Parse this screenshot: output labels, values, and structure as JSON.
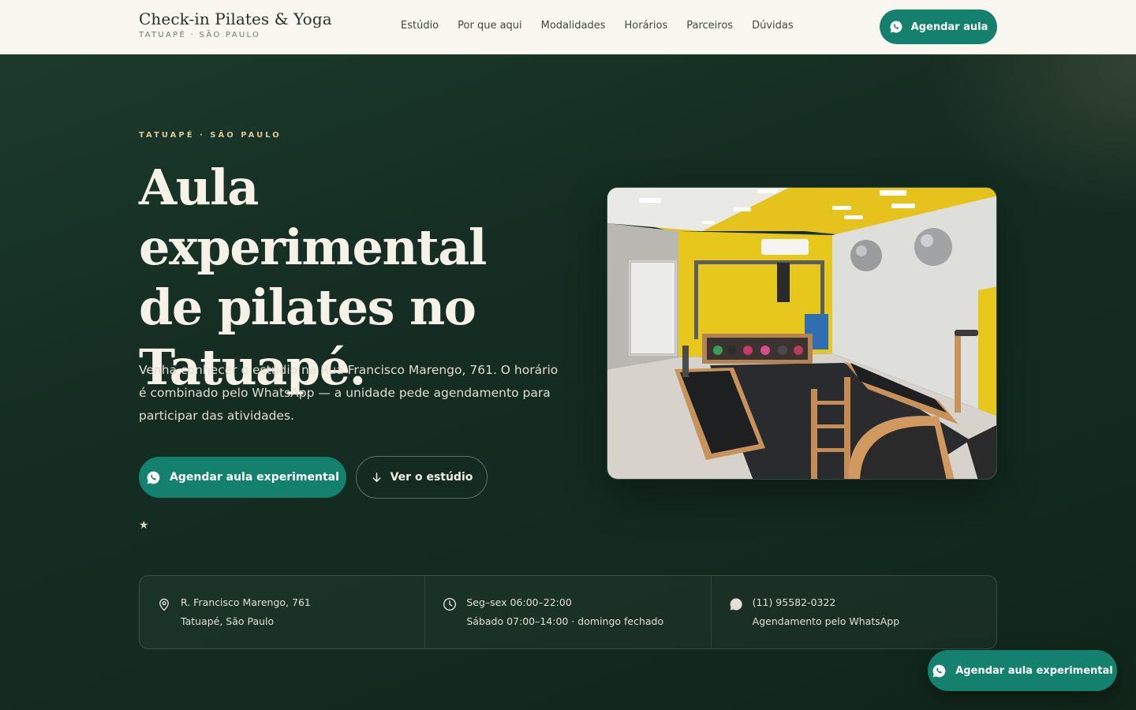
{
  "header": {
    "brand_name": "Check-in Pilates & Yoga",
    "brand_sub": "TATUAPÉ · SÃO PAULO",
    "nav": [
      "Estúdio",
      "Por que aqui",
      "Modalidades",
      "Horários",
      "Parceiros",
      "Dúvidas"
    ],
    "cta_label": "Agendar aula",
    "cta_icon": "whatsapp-icon"
  },
  "hero": {
    "kicker": "TATUAPÉ · SÃO PAULO",
    "title_lines": [
      "Aula experimental",
      "de pilates no",
      "Tatuapé."
    ],
    "lead": "Venha conhecer o estúdio na Rua Francisco Marengo, 761. O horário é combinado pelo WhatsApp — a unidade pede agendamento para participar das atividades.",
    "primary_cta": "Agendar aula experimental",
    "secondary_cta": "Ver o estúdio",
    "secondary_icon": "arrow-down-icon",
    "rating_icon": "star-icon"
  },
  "info": [
    {
      "icon": "map-pin-icon",
      "line1": "R. Francisco Marengo, 761",
      "line2": "Tatuapé, São Paulo"
    },
    {
      "icon": "clock-icon",
      "line1": "Seg–sex 06:00–22:00",
      "line2": "Sábado 07:00–14:00 · domingo fechado"
    },
    {
      "icon": "chat-bubble-icon",
      "line1": "(11) 95582-0322",
      "line2": "Agendamento pelo WhatsApp"
    }
  ],
  "floating_cta": "Agendar aula experimental",
  "colors": {
    "accent": "#14806e",
    "hero_bg": "#142a20",
    "header_bg": "#faf7f0",
    "kicker": "#d8c797"
  }
}
